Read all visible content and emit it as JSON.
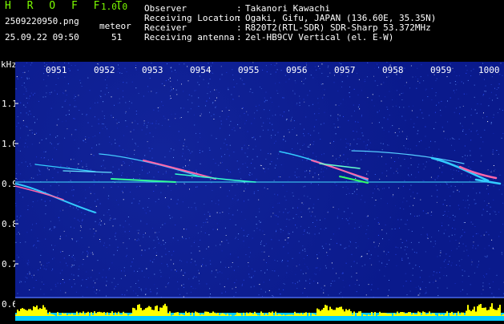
{
  "header": {
    "app_title": "H R O F F T",
    "app_version": "1.0.0",
    "filename": "2509220950.png",
    "datetime": "25.09.22 09:50",
    "meteor_label": "meteor",
    "meteor_count": "51"
  },
  "info": [
    {
      "label": "Observer",
      "value": "Takanori Kawachi"
    },
    {
      "label": "Receiving Location",
      "value": "Ogaki, Gifu, JAPAN (136.60E, 35.35N)"
    },
    {
      "label": "Receiver",
      "value": "R820T2(RTL-SDR) SDR-Sharp 53.372MHz"
    },
    {
      "label": "Receiving antenna",
      "value": "2el-HB9CV Vertical (el. E-W)"
    }
  ],
  "spectrogram": {
    "unit": "kHz",
    "freq_ticks": [
      "1.1",
      "1.0",
      "0.9",
      "0.8",
      "0.7",
      "0.6"
    ],
    "time_ticks": [
      "0951",
      "0952",
      "0953",
      "0954",
      "0955",
      "0956",
      "0957",
      "0958",
      "0959",
      "1000"
    ],
    "colors": {
      "background": "#0a1a8c",
      "trace": "#33ccff",
      "trace_hot": "#ff66aa",
      "text_accent": "#7CFC00",
      "power_fill": "#ffff00",
      "power_base": "#00ccff"
    }
  }
}
